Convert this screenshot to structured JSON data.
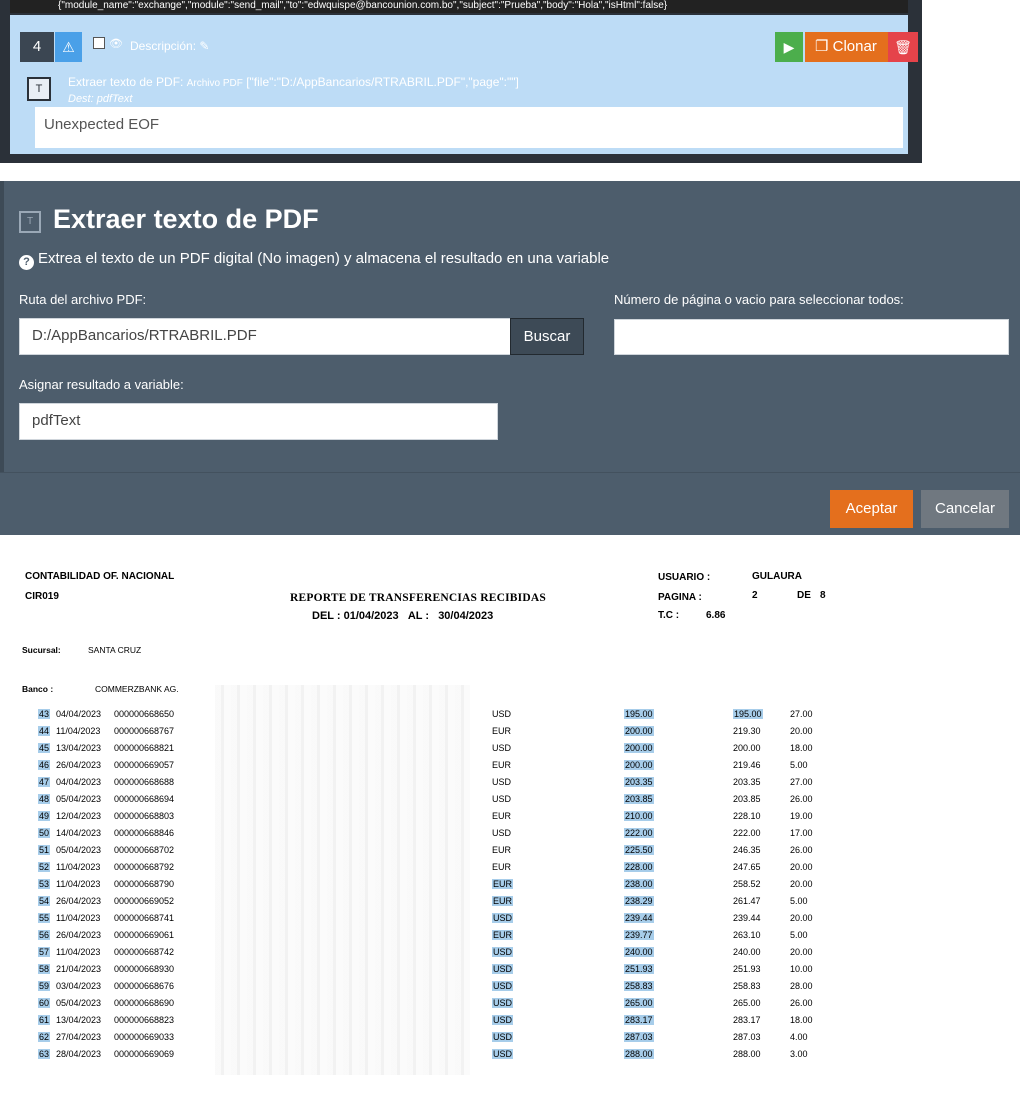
{
  "editor": {
    "code_line": "{\"module_name\":\"exchange\",\"module\":\"send_mail\",\"to\":\"edwquispe@bancounion.com.bo\",\"subject\":\"Prueba\",\"body\":\"Hola\",\"isHtml\":false}",
    "step": {
      "number": "4",
      "warning_icon": "warning-icon",
      "description_label": "Descripción:",
      "clone_label": "Clonar",
      "module_title": "Extraer texto de PDF:",
      "module_param_label": "Archivo PDF",
      "module_params": "[\"file\":\"D:/AppBancarios/RTRABRIL.PDF\",\"page\":\"\"]",
      "dest_label": "Dest:",
      "dest_value": "pdfText",
      "error": "Unexpected EOF"
    }
  },
  "dialog": {
    "title": "Extraer texto de PDF",
    "help_text": "Extrea el texto de un PDF digital (No imagen) y almacena el resultado en una variable",
    "file_label": "Ruta del archivo PDF:",
    "file_value": "D:/AppBancarios/RTRABRIL.PDF",
    "browse_label": "Buscar",
    "page_label": "Número de página o vacio para seleccionar todos:",
    "page_value": "",
    "variable_label": "Asignar resultado a variable:",
    "variable_value": "pdfText",
    "accept_label": "Aceptar",
    "cancel_label": "Cancelar",
    "colors": {
      "accept": "#e46f1d",
      "cancel": "#707880",
      "dialog_bg": "#4d5d6c"
    }
  },
  "report": {
    "org": "CONTABILIDAD OF. NACIONAL",
    "code": "CIR019",
    "title": "REPORTE DE TRANSFERENCIAS RECIBIDAS",
    "del_label": "DEL :",
    "del_value": "01/04/2023",
    "al_label": "AL :",
    "al_value": "30/04/2023",
    "user_label": "USUARIO :",
    "user_value": "GULAURA",
    "page_label": "PAGINA :",
    "page_value": "2",
    "de_label": "DE",
    "de_value": "8",
    "tc_label": "T.C :",
    "tc_value": "6.86",
    "branch_label": "Sucursal:",
    "branch_value": "SANTA CRUZ",
    "bank_label": "Banco :",
    "bank_value": "COMMERZBANK AG.",
    "rows": [
      {
        "n": "43",
        "date": "04/04/2023",
        "ref": "000000668650",
        "cur": "USD",
        "amount": "195.00",
        "usd": "195.00",
        "fee": "27.00"
      },
      {
        "n": "44",
        "date": "11/04/2023",
        "ref": "000000668767",
        "cur": "EUR",
        "amount": "200.00",
        "usd": "219.30",
        "fee": "20.00"
      },
      {
        "n": "45",
        "date": "13/04/2023",
        "ref": "000000668821",
        "cur": "USD",
        "amount": "200.00",
        "usd": "200.00",
        "fee": "18.00"
      },
      {
        "n": "46",
        "date": "26/04/2023",
        "ref": "000000669057",
        "cur": "EUR",
        "amount": "200.00",
        "usd": "219.46",
        "fee": "5.00"
      },
      {
        "n": "47",
        "date": "04/04/2023",
        "ref": "000000668688",
        "cur": "USD",
        "amount": "203.35",
        "usd": "203.35",
        "fee": "27.00"
      },
      {
        "n": "48",
        "date": "05/04/2023",
        "ref": "000000668694",
        "cur": "USD",
        "amount": "203.85",
        "usd": "203.85",
        "fee": "26.00"
      },
      {
        "n": "49",
        "date": "12/04/2023",
        "ref": "000000668803",
        "cur": "EUR",
        "amount": "210.00",
        "usd": "228.10",
        "fee": "19.00"
      },
      {
        "n": "50",
        "date": "14/04/2023",
        "ref": "000000668846",
        "cur": "USD",
        "amount": "222.00",
        "usd": "222.00",
        "fee": "17.00"
      },
      {
        "n": "51",
        "date": "05/04/2023",
        "ref": "000000668702",
        "cur": "EUR",
        "amount": "225.50",
        "usd": "246.35",
        "fee": "26.00"
      },
      {
        "n": "52",
        "date": "11/04/2023",
        "ref": "000000668792",
        "cur": "EUR",
        "amount": "228.00",
        "usd": "247.65",
        "fee": "20.00"
      },
      {
        "n": "53",
        "date": "11/04/2023",
        "ref": "000000668790",
        "cur": "EUR",
        "amount": "238.00",
        "usd": "258.52",
        "fee": "20.00"
      },
      {
        "n": "54",
        "date": "26/04/2023",
        "ref": "000000669052",
        "cur": "EUR",
        "amount": "238.29",
        "usd": "261.47",
        "fee": "5.00"
      },
      {
        "n": "55",
        "date": "11/04/2023",
        "ref": "000000668741",
        "cur": "USD",
        "amount": "239.44",
        "usd": "239.44",
        "fee": "20.00"
      },
      {
        "n": "56",
        "date": "26/04/2023",
        "ref": "000000669061",
        "cur": "EUR",
        "amount": "239.77",
        "usd": "263.10",
        "fee": "5.00"
      },
      {
        "n": "57",
        "date": "11/04/2023",
        "ref": "000000668742",
        "cur": "USD",
        "amount": "240.00",
        "usd": "240.00",
        "fee": "20.00"
      },
      {
        "n": "58",
        "date": "21/04/2023",
        "ref": "000000668930",
        "cur": "USD",
        "amount": "251.93",
        "usd": "251.93",
        "fee": "10.00"
      },
      {
        "n": "59",
        "date": "03/04/2023",
        "ref": "000000668676",
        "cur": "USD",
        "amount": "258.83",
        "usd": "258.83",
        "fee": "28.00"
      },
      {
        "n": "60",
        "date": "05/04/2023",
        "ref": "000000668690",
        "cur": "USD",
        "amount": "265.00",
        "usd": "265.00",
        "fee": "26.00"
      },
      {
        "n": "61",
        "date": "13/04/2023",
        "ref": "000000668823",
        "cur": "USD",
        "amount": "283.17",
        "usd": "283.17",
        "fee": "18.00"
      },
      {
        "n": "62",
        "date": "27/04/2023",
        "ref": "000000669033",
        "cur": "USD",
        "amount": "287.03",
        "usd": "287.03",
        "fee": "4.00"
      },
      {
        "n": "63",
        "date": "28/04/2023",
        "ref": "000000669069",
        "cur": "USD",
        "amount": "288.00",
        "usd": "288.00",
        "fee": "3.00"
      }
    ]
  }
}
